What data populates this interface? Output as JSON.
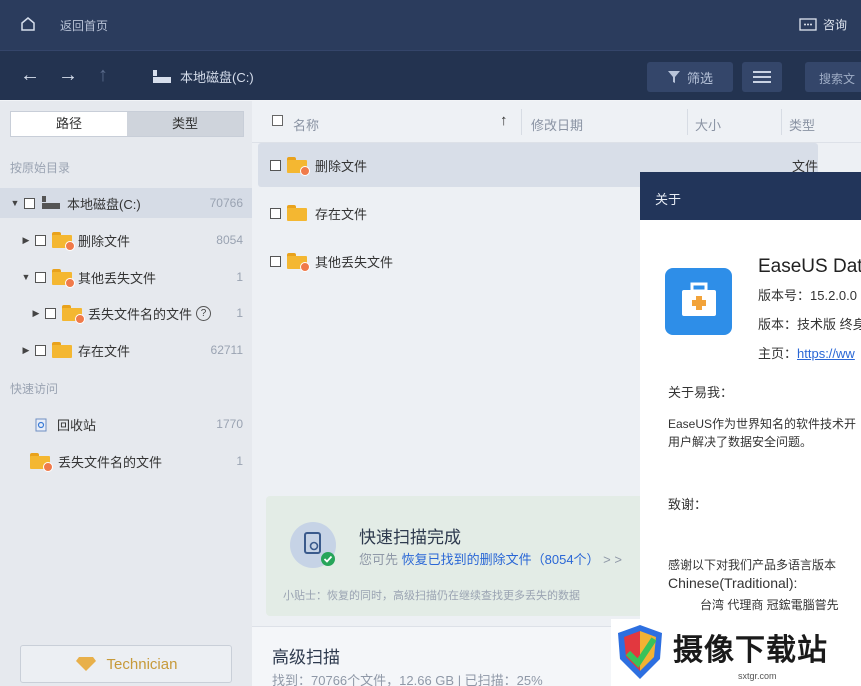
{
  "topbar": {
    "home_label": "返回首页",
    "consult_label": "咨询"
  },
  "navbar": {
    "path_label": "本地磁盘(C:)",
    "filter_label": "筛选",
    "search_placeholder": "搜索文"
  },
  "sidebar": {
    "tabs": [
      {
        "label": "路径",
        "active": true
      },
      {
        "label": "类型",
        "active": false
      }
    ],
    "section_original": "按原始目录",
    "tree": [
      {
        "label": "本地磁盘(C:)",
        "count": "70766",
        "expanded": true
      },
      {
        "label": "删除文件",
        "count": "8054",
        "expanded": false
      },
      {
        "label": "其他丢失文件",
        "count": "1",
        "expanded": true
      },
      {
        "label": "丢失文件名的文件",
        "count": "1",
        "expanded": false
      },
      {
        "label": "存在文件",
        "count": "62711",
        "expanded": false
      }
    ],
    "section_quick": "快速访问",
    "quick": [
      {
        "label": "回收站",
        "count": "1770"
      },
      {
        "label": "丢失文件名的文件",
        "count": "1"
      }
    ],
    "technician_label": "Technician"
  },
  "columns": {
    "name": "名称",
    "sort_arrow": "↑",
    "modified": "修改日期",
    "size": "大小",
    "type": "类型"
  },
  "files": [
    {
      "name": "删除文件",
      "type": "文件"
    },
    {
      "name": "存在文件",
      "type": ""
    },
    {
      "name": "其他丢失文件",
      "type": ""
    }
  ],
  "scan": {
    "title": "快速扫描完成",
    "sub_prefix": "您可先 ",
    "sub_link": "恢复已找到的删除文件（8054个）",
    "sub_suffix": " > >",
    "tip": "小贴士：恢复的同时，高级扫描仍在继续查找更多丢失的数据"
  },
  "advanced": {
    "title": "高级扫描",
    "stats": "找到：70766个文件，12.66 GB | 已扫描：25%"
  },
  "about": {
    "title": "关于",
    "app_name": "EaseUS Dat",
    "version": "版本号：15.2.0.0",
    "edition": "版本：技术版 终身",
    "homepage_label": "主页：",
    "homepage_url": "https://ww",
    "about_heading": "关于易我：",
    "about_text_1": "EaseUS作为世界知名的软件技术开",
    "about_text_2": "用户解决了数据安全问题。",
    "thanks_heading": "致谢：",
    "thanks_text": "感谢以下对我们产品多语言版本",
    "lang": "Chinese(Traditional):",
    "credit": "台湾 代理商 冠鋐電腦嘗先"
  },
  "watermark": {
    "text": "摄像下载站",
    "url": "sxtgr.com"
  }
}
